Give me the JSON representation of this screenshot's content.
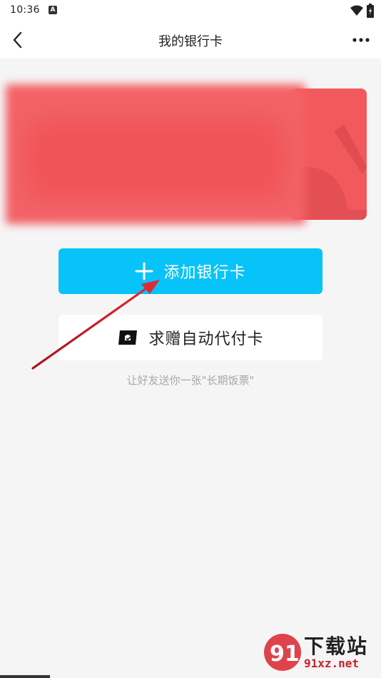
{
  "status_bar": {
    "time": "10:36",
    "notification_icon": "a-square-icon",
    "wifi_icon": "wifi-icon",
    "battery_icon": "battery-icon"
  },
  "nav": {
    "back_icon": "chevron-left-icon",
    "title": "我的银行卡",
    "more_icon": "more-horizontal-icon"
  },
  "colors": {
    "primary_button": "#08c3f7",
    "card_red": "#f2595d",
    "background": "#f5f5f5",
    "arrow": "#d0222c"
  },
  "actions": {
    "add_card_label": "添加银行卡",
    "add_card_icon": "plus-icon",
    "request_card_label": "求赠自动代付卡",
    "request_card_icon": "ticket-icon"
  },
  "hint": "让好友送你一张\"长期饭票\"",
  "watermark": {
    "name": "下载站",
    "domain": "91xz.net"
  }
}
